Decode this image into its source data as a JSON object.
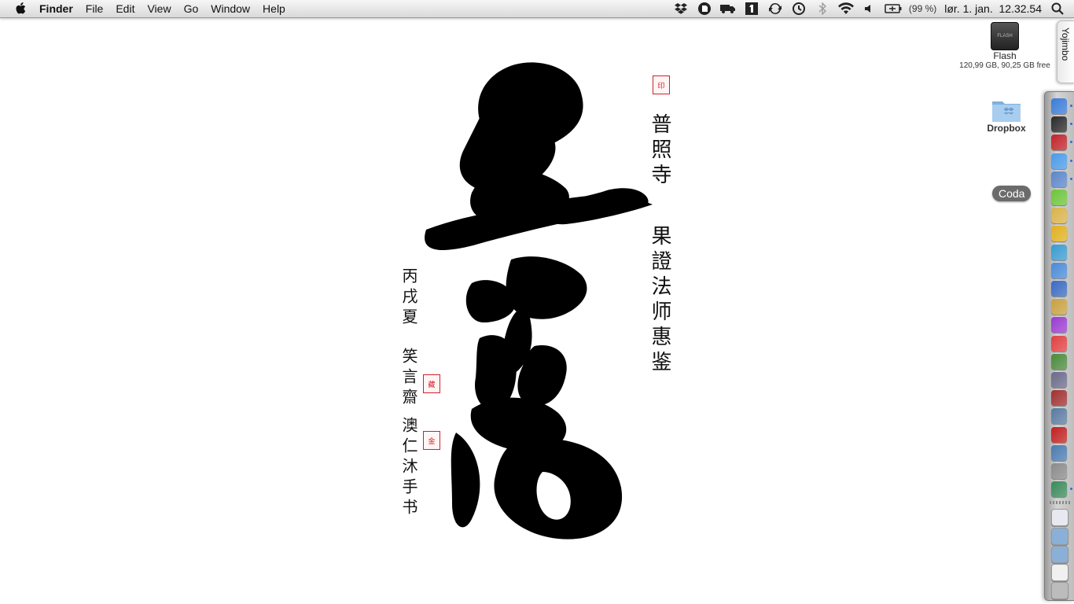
{
  "menubar": {
    "app_name": "Finder",
    "menus": [
      "File",
      "Edit",
      "View",
      "Go",
      "Window",
      "Help"
    ],
    "status_icons": [
      "dropbox-icon",
      "evernote-icon",
      "truck-icon",
      "one-password-icon",
      "sync-icon",
      "time-machine-icon",
      "bluetooth-icon",
      "wifi-icon",
      "volume-icon",
      "battery-icon"
    ],
    "battery_text": "(99 %)",
    "clock": "lør. 1. jan.  12.32.54"
  },
  "wallpaper": {
    "right_column": "普照寺",
    "right_column_2": "果證法师惠鉴",
    "left_column_1": "丙戌夏",
    "left_column_2": "笑言齋",
    "left_column_3": "澳仁沐手书",
    "seal_top": "印",
    "seal_mid": "藏",
    "seal_low": "金"
  },
  "desktop": {
    "flash": {
      "label": "Flash",
      "sub": "120,99 GB, 90,25 GB free",
      "chip_text": "FLASH"
    },
    "dropbox": {
      "label": "Dropbox"
    },
    "yojimbo_tab": "Yojimbo",
    "coda_label": "Coda"
  },
  "dock": {
    "items": [
      {
        "name": "finder",
        "color": "#3b7bd8"
      },
      {
        "name": "dashboard",
        "color": "#2a2a2a"
      },
      {
        "name": "red-app",
        "color": "#c0242a"
      },
      {
        "name": "safari",
        "color": "#4a9ae8"
      },
      {
        "name": "preview",
        "color": "#5a86c8"
      },
      {
        "name": "coda",
        "color": "#6cc43a"
      },
      {
        "name": "folders",
        "color": "#d8b24a"
      },
      {
        "name": "smile",
        "color": "#e0b020"
      },
      {
        "name": "world",
        "color": "#3a9ad0"
      },
      {
        "name": "mail",
        "color": "#4a8ad8"
      },
      {
        "name": "xcode",
        "color": "#3a6ac0"
      },
      {
        "name": "notes",
        "color": "#c8a040"
      },
      {
        "name": "purple-app",
        "color": "#9a3ad0"
      },
      {
        "name": "calendar",
        "color": "#e04040"
      },
      {
        "name": "chart",
        "color": "#4a8a3a"
      },
      {
        "name": "pen",
        "color": "#6a6a8a"
      },
      {
        "name": "books",
        "color": "#a03030"
      },
      {
        "name": "photos",
        "color": "#5a7aa0"
      },
      {
        "name": "film",
        "color": "#c02020"
      },
      {
        "name": "globe",
        "color": "#4a7ab0"
      },
      {
        "name": "screenshot",
        "color": "#8a8a8a"
      },
      {
        "name": "display",
        "color": "#3a8a5a"
      }
    ],
    "stack_items": [
      {
        "name": "at-doc",
        "color": "#e8e8f0"
      },
      {
        "name": "folder-1",
        "color": "#8ab0d8"
      },
      {
        "name": "folder-2",
        "color": "#8ab0d8"
      },
      {
        "name": "document",
        "color": "#f0f0f0"
      },
      {
        "name": "trash",
        "color": "#bcbcbc"
      }
    ]
  }
}
